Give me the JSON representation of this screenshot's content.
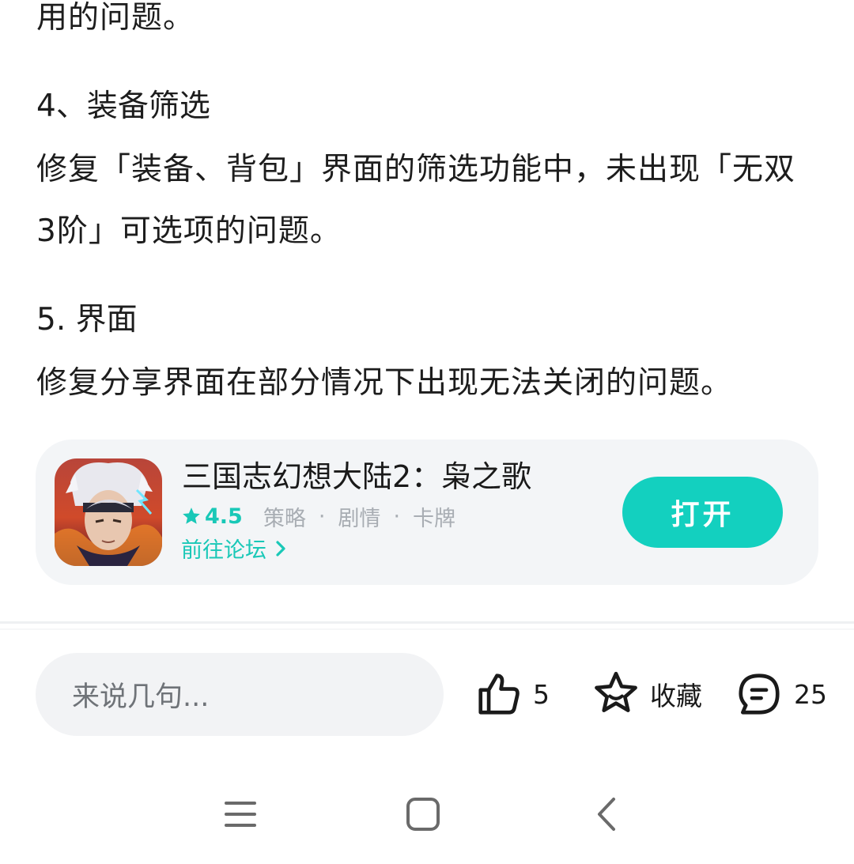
{
  "article": {
    "paragraph_end": "用的问题。",
    "section4_title": "4、装备筛选",
    "section4_body": "修复「装备、背包」界面的筛选功能中，未出现「无双3阶」可选项的问题。",
    "section5_title": "5. 界面",
    "section5_body": "修复分享界面在部分情况下出现无法关闭的问题。"
  },
  "game_card": {
    "title": "三国志幻想大陆2：枭之歌",
    "rating": "4.5",
    "tags": [
      "策略",
      "剧情",
      "卡牌"
    ],
    "forum_link": "前往论坛",
    "open_button": "打开",
    "accent_color": "#13d0bf"
  },
  "bottom_bar": {
    "comment_placeholder": "来说几句...",
    "like_count": "5",
    "favorite_label": "收藏",
    "comment_count": "25"
  },
  "nav_bar": {
    "icons": [
      "menu-icon",
      "home-icon",
      "back-icon"
    ]
  }
}
